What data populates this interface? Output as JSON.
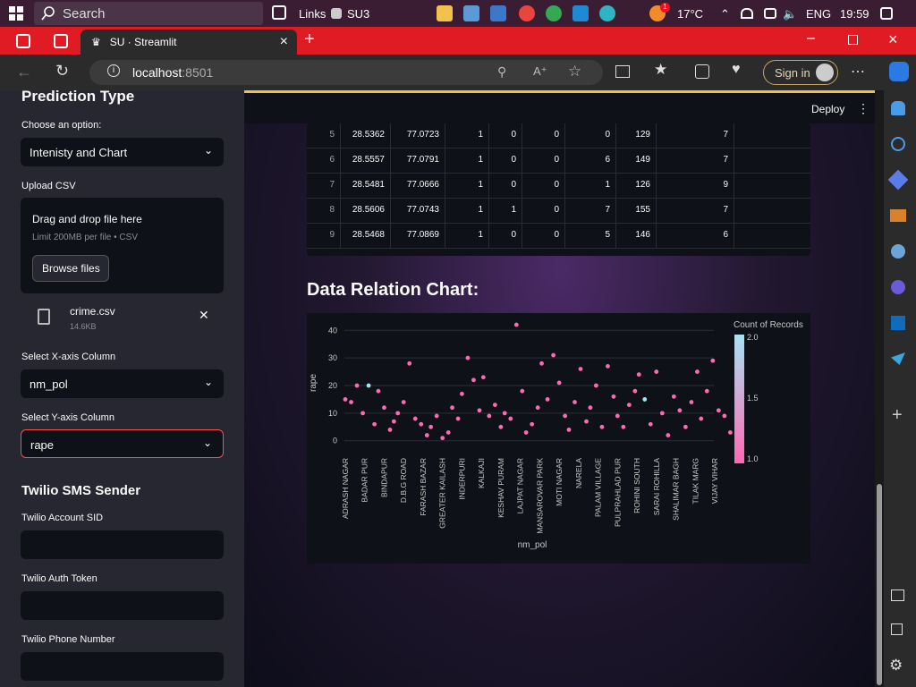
{
  "taskbar": {
    "search_placeholder": "Search",
    "links_label": "Links",
    "su3_label": "SU3",
    "temperature": "17°C",
    "language": "ENG",
    "time": "19:59",
    "weather_badge": "1"
  },
  "browser": {
    "tab_title": "SU · Streamlit",
    "url_host": "localhost",
    "url_port": ":8501",
    "sign_in": "Sign in"
  },
  "sidebar": {
    "prediction_heading": "Prediction Type",
    "choose_label": "Choose an option:",
    "choose_value": "Intenisty and Chart",
    "upload_label": "Upload CSV",
    "drag_text": "Drag and drop file here",
    "limit_text": "Limit 200MB per file • CSV",
    "browse_label": "Browse files",
    "file_name": "crime.csv",
    "file_size": "14.6KB",
    "x_label": "Select X-axis Column",
    "x_value": "nm_pol",
    "y_label": "Select Y-axis Column",
    "y_value": "rape",
    "twilio_heading": "Twilio SMS Sender",
    "sid_label": "Twilio Account SID",
    "token_label": "Twilio Auth Token",
    "phone_label": "Twilio Phone Number"
  },
  "header": {
    "deploy": "Deploy"
  },
  "table": {
    "rows": [
      [
        "5",
        "28.5362",
        "77.0723",
        "1",
        "0",
        "0",
        "0",
        "129",
        "7"
      ],
      [
        "6",
        "28.5557",
        "77.0791",
        "1",
        "0",
        "0",
        "6",
        "149",
        "7"
      ],
      [
        "7",
        "28.5481",
        "77.0666",
        "1",
        "0",
        "0",
        "1",
        "126",
        "9"
      ],
      [
        "8",
        "28.5606",
        "77.0743",
        "1",
        "1",
        "0",
        "7",
        "155",
        "7"
      ],
      [
        "9",
        "28.5468",
        "77.0869",
        "1",
        "0",
        "0",
        "5",
        "146",
        "6"
      ]
    ]
  },
  "chart_heading": "Data Relation Chart:",
  "chart_data": {
    "type": "scatter",
    "xlabel": "nm_pol",
    "ylabel": "rape",
    "ylim": [
      -3,
      43
    ],
    "yticks": [
      0,
      10,
      20,
      30,
      40
    ],
    "tick_labels": [
      "ADRASH NAGAR",
      "BADAR PUR",
      "BINDAPUR",
      "D.B.G ROAD",
      "FARASH BAZAR",
      "GREATER KAILASH",
      "INDERPURI",
      "KALKAJI",
      "KESHAV PURAM",
      "LAJPAT NAGAR",
      "MANSAROVAR PARK",
      "MOTI NAGAR",
      "NARELA",
      "PALAM VILLAGE",
      "PULPRAHLAD PUR",
      "ROHINI SOUTH",
      "SARAI ROHILLA",
      "SHALIMAR BAGH",
      "TILAK MARG",
      "VIJAY VIHAR"
    ],
    "legend_title": "Count of Records",
    "colorbar_ticks": [
      "2.0",
      "1.5",
      "1.0"
    ],
    "colors": {
      "low": "#ff69b4",
      "high": "#a6e3f5"
    },
    "series": [
      {
        "x_index": [
          0,
          0.3,
          0.6,
          0.9,
          1.2,
          1.5,
          1.7,
          2,
          2.3,
          2.5,
          2.7,
          3,
          3.3,
          3.6,
          3.9,
          4.2,
          4.4,
          4.7,
          5,
          5.3,
          5.5,
          5.8,
          6,
          6.3,
          6.6,
          6.9,
          7.1,
          7.4,
          7.7,
          8,
          8.2,
          8.5,
          8.8,
          9.1,
          9.3,
          9.6,
          9.9,
          10.1,
          10.4,
          10.7,
          11,
          11.3,
          11.5,
          11.8,
          12.1,
          12.4,
          12.6,
          12.9,
          13.2,
          13.5,
          13.8,
          14,
          14.3,
          14.6,
          14.9,
          15.1,
          15.4,
          15.7,
          16,
          16.3,
          16.6,
          16.9,
          17.2,
          17.5,
          17.8,
          18.1,
          18.3,
          18.6,
          18.9,
          19.2,
          19.5,
          19.8
        ],
        "y": [
          15,
          14,
          20,
          10,
          20,
          6,
          18,
          12,
          4,
          7,
          10,
          14,
          28,
          8,
          6,
          2,
          5,
          9,
          1,
          3,
          12,
          8,
          17,
          30,
          22,
          11,
          23,
          9,
          13,
          5,
          10,
          8,
          42,
          18,
          3,
          6,
          12,
          28,
          15,
          31,
          21,
          9,
          4,
          14,
          26,
          7,
          12,
          20,
          5,
          27,
          16,
          9,
          5,
          13,
          18,
          24,
          15,
          6,
          25,
          10,
          2,
          16,
          11,
          5,
          14,
          25,
          8,
          18,
          29,
          11,
          9,
          3
        ],
        "count": [
          1,
          1,
          1,
          1,
          2,
          1,
          1,
          1,
          1,
          1,
          1,
          1,
          1,
          1,
          1,
          1,
          1,
          1,
          1,
          1,
          1,
          1,
          1,
          1,
          1,
          1,
          1,
          1,
          1,
          1,
          1,
          1,
          1,
          1,
          1,
          1,
          1,
          1,
          1,
          1,
          1,
          1,
          1,
          1,
          1,
          1,
          1,
          1,
          1,
          1,
          1,
          1,
          1,
          1,
          1,
          1,
          2,
          1,
          1,
          1,
          1,
          1,
          1,
          1,
          1,
          1,
          1,
          1,
          1,
          1,
          1,
          1
        ]
      }
    ]
  }
}
